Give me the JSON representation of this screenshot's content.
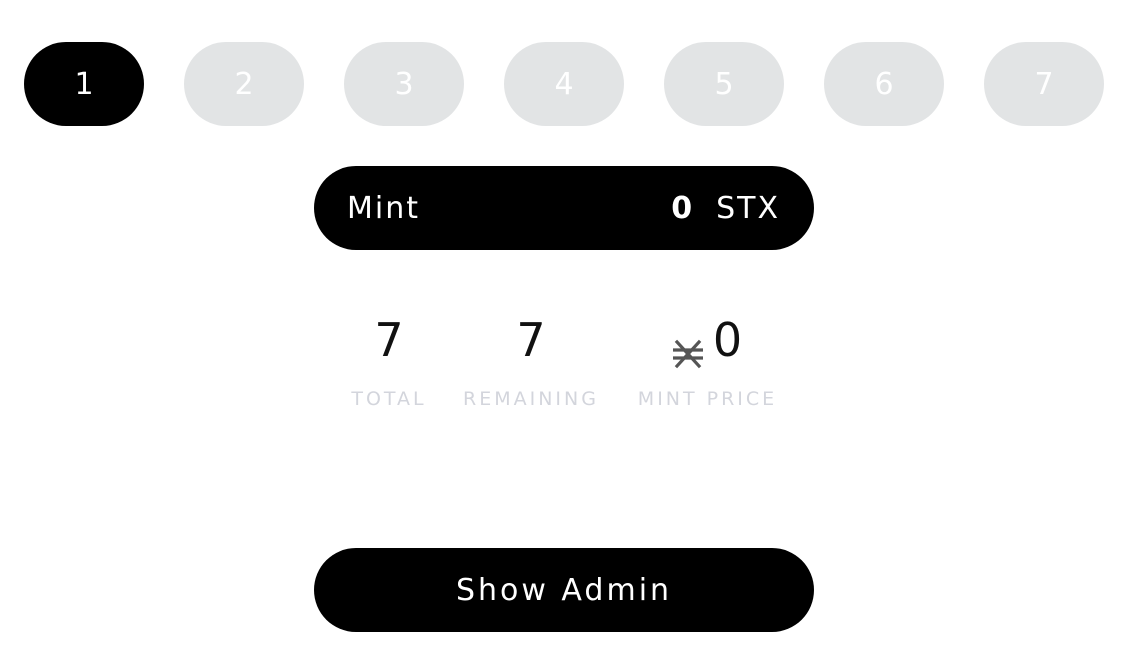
{
  "tabs": [
    {
      "label": "1",
      "active": true
    },
    {
      "label": "2",
      "active": false
    },
    {
      "label": "3",
      "active": false
    },
    {
      "label": "4",
      "active": false
    },
    {
      "label": "5",
      "active": false
    },
    {
      "label": "6",
      "active": false
    },
    {
      "label": "7",
      "active": false
    }
  ],
  "mint": {
    "label": "Mint",
    "amount": "0",
    "currency": "STX"
  },
  "stats": {
    "total": {
      "value": "7",
      "label": "TOTAL"
    },
    "remaining": {
      "value": "7",
      "label": "REMAINING"
    },
    "price": {
      "value": "0",
      "label": "MINT PRICE",
      "icon": "stacks-currency-icon"
    }
  },
  "admin": {
    "label": "Show Admin"
  },
  "colors": {
    "active_tab": "#000000",
    "inactive_tab": "#e2e4e5",
    "button_bg": "#000000",
    "label_gray": "#d3d5dc"
  }
}
